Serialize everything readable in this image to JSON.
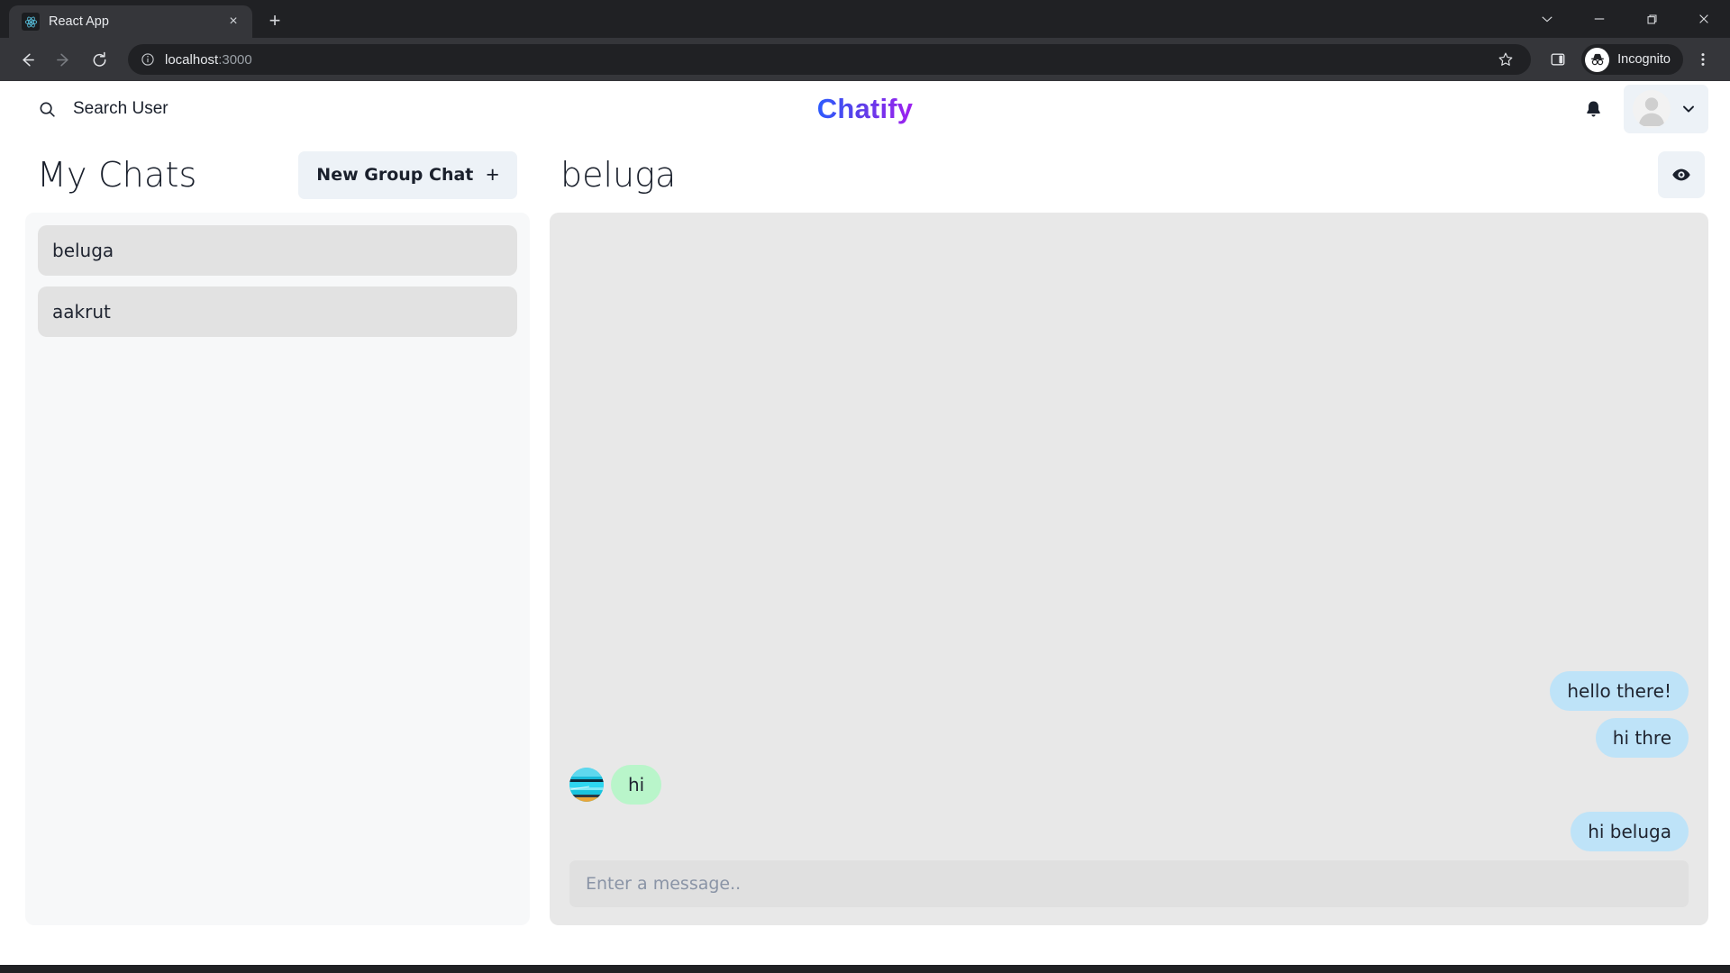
{
  "browser": {
    "tab": {
      "title": "React App",
      "favicon": "react-logo-icon",
      "close": "×"
    },
    "new_tab": "+",
    "window_controls": {
      "minimize_alt": "⌄",
      "minimize": "–",
      "maximize": "❐",
      "close": "✕"
    },
    "nav": {
      "back": "←",
      "forward": "→",
      "reload": "↻"
    },
    "omnibox": {
      "info_icon": "site-info-icon",
      "url_host": "localhost",
      "url_rest": ":3000",
      "star_icon": "bookmark-star-icon"
    },
    "side_panel_icon": "side-panel-icon",
    "incognito_label": "Incognito",
    "menu_icon": "three-dot-menu-icon"
  },
  "header": {
    "search_label": "Search User",
    "search_icon": "search-icon",
    "brand": "Chatify",
    "brand_gradient_from": "#2b5cff",
    "brand_gradient_to": "#a01ff0",
    "bell_icon": "notification-bell-icon",
    "avatar_icon": "user-avatar-icon",
    "chevron_icon": "chevron-down-icon"
  },
  "sidebar": {
    "title": "My Chats",
    "new_group_label": "New Group Chat",
    "new_group_plus": "+",
    "chats": [
      {
        "name": "beluga"
      },
      {
        "name": "aakrut"
      }
    ]
  },
  "chat": {
    "title": "beluga",
    "eye_icon": "eye-icon",
    "messages": [
      {
        "text": "hello there!",
        "direction": "out"
      },
      {
        "text": "hi thre",
        "direction": "out"
      },
      {
        "text": "hi",
        "direction": "in",
        "avatar": "beluga-avatar-beach-photo"
      },
      {
        "text": "hi beluga",
        "direction": "out"
      }
    ],
    "input_placeholder": "Enter a message..",
    "input_value": "",
    "colors": {
      "outgoing_bubble": "#bee3f8",
      "incoming_bubble": "#b9f5ca",
      "chat_background": "#e8e8e8",
      "sidebar_background": "#f7f8f9",
      "chat_item_background": "#e2e2e2"
    }
  }
}
